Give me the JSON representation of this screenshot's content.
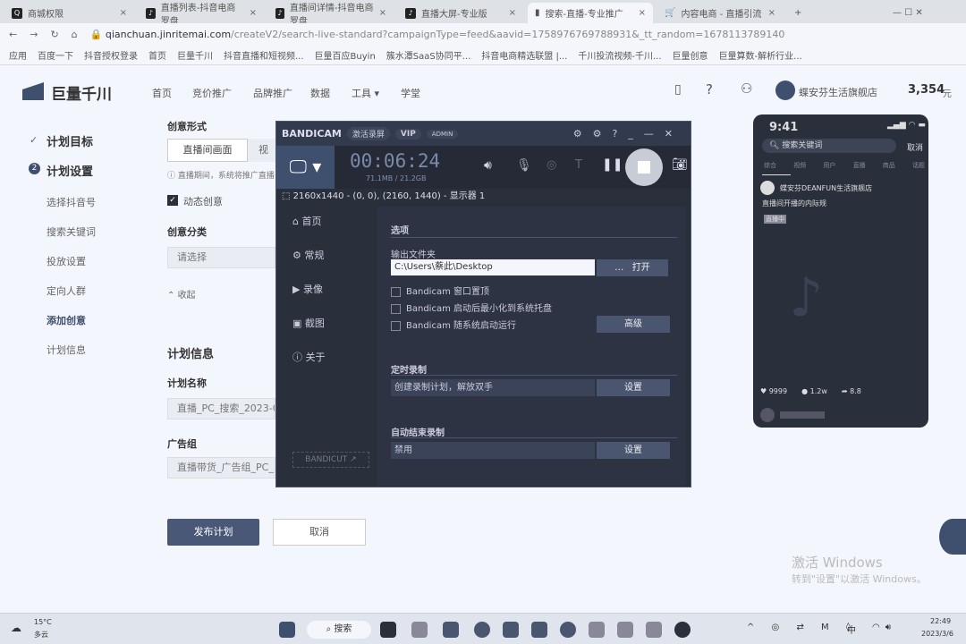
{
  "browser": {
    "tabs": [
      {
        "label": "商城权限",
        "icon": "qianchuan-icon"
      },
      {
        "label": "直播列表-抖音电商罗盘",
        "icon": "tiktok-icon"
      },
      {
        "label": "直播间详情-抖音电商罗盘",
        "icon": "tiktok-icon"
      },
      {
        "label": "直播大屏-专业版",
        "icon": "tiktok-icon"
      },
      {
        "label": "搜索-直播-专业推广",
        "icon": "bars-icon",
        "active": true
      },
      {
        "label": "内容电商 - 直播引流",
        "icon": "cart-icon"
      }
    ],
    "url_host": "qianchuan.jinritemai.com",
    "url_path": "/createV2/search-live-standard?campaignType=feed&aavid=1758976769788931&_tt_random=1678113789140",
    "bookmarks": [
      "应用",
      "百度一下",
      "抖音授权登录",
      "首页",
      "巨量千川",
      "抖音直播和短视频...",
      "巨量百应Buyin",
      "簇水潭SaaS协同平...",
      "抖音电商精选联盟 |...",
      "千川投流视频-千川...",
      "巨量创意",
      "巨量算数-解析行业..."
    ]
  },
  "header": {
    "logo": "巨量千川",
    "nav": [
      "首页",
      "竞价推广",
      "品牌推广",
      "数据",
      "工具",
      "学堂"
    ],
    "store": "蝶安芬生活旗舰店",
    "balance": "3,354",
    "currency": "元"
  },
  "steps": {
    "done": "计划目标",
    "current_num": "2",
    "current": "计划设置",
    "items": [
      "选择抖音号",
      "搜索关键词",
      "投放设置",
      "定向人群",
      "添加创意",
      "计划信息"
    ]
  },
  "form": {
    "creative_form": "创意形式",
    "opt1": "直播间画面",
    "opt2": "视频",
    "note": "直播期间，系统将推广直播",
    "dynamic": "动态创意",
    "category": "创意分类",
    "category_ph": "请选择",
    "collapse": "收起",
    "plan_info": "计划信息",
    "plan_name": "计划名称",
    "plan_name_val": "直播_PC_搜索_2023-03-",
    "adgroup": "广告组",
    "adgroup_val": "直播带货_广告组_PC_",
    "publish": "发布计划",
    "cancel": "取消"
  },
  "bandicam": {
    "logo": "BANDICAM",
    "pill": "激活录屏",
    "vip": "VIP",
    "admin": "ADMIN",
    "timer": "00:06:24",
    "size": "71.1MB / 21.2GB",
    "area": "2160x1440 - (0, 0), (2160, 1440) - 显示器 1",
    "side": [
      "首页",
      "常规",
      "录像",
      "截图",
      "关于"
    ],
    "bandicut": "BANDICUT ↗",
    "options": "选项",
    "output": "输出文件夹",
    "path": "C:\\Users\\蔡此\\Desktop",
    "open": "打开",
    "checks": [
      "Bandicam 窗口置顶",
      "Bandicam 启动后最小化到系统托盘",
      "Bandicam 随系统启动运行"
    ],
    "advanced": "高级",
    "timed": "定时录制",
    "timed_val": "创建录制计划，解放双手",
    "set": "设置",
    "autoend": "自动结束录制",
    "autoend_val": "禁用"
  },
  "phone": {
    "time": "9:41",
    "search": "搜索关键词",
    "cancel": "取消",
    "tabs": [
      "综合",
      "视频",
      "用户",
      "直播",
      "商品",
      "话题"
    ],
    "account": "蝶安芬DEANFUN生活旗舰店",
    "desc": "直播间开播的内际规",
    "tag": "直播中",
    "likes": "9999",
    "comments": "1.2w",
    "shares": "8.8"
  },
  "watermark": {
    "line1": "激活 Windows",
    "line2": "转到\"设置\"以激活 Windows。"
  },
  "taskbar": {
    "temp": "15°C",
    "weather": "多云",
    "search": "搜索",
    "time": "22:49",
    "date": "2023/3/6",
    "ime": "中"
  }
}
